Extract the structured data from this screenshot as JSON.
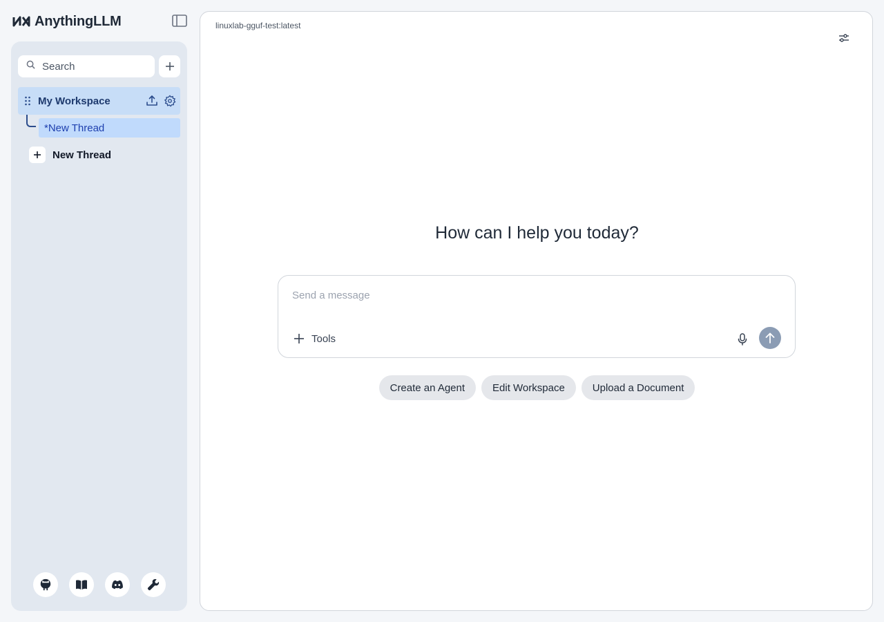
{
  "app": {
    "name": "AnythingLLM"
  },
  "sidebar": {
    "search_placeholder": "Search",
    "workspace": {
      "name": "My Workspace",
      "threads": [
        {
          "label": "*New Thread",
          "active": true
        }
      ]
    },
    "new_thread_label": "New Thread",
    "footer_icons": [
      "github-icon",
      "docs-book-icon",
      "discord-icon",
      "wrench-icon"
    ]
  },
  "main": {
    "model_name": "linuxlab-gguf-test:latest",
    "greeting": "How can I help you today?",
    "composer": {
      "placeholder": "Send a message",
      "value": "",
      "tools_label": "Tools"
    },
    "suggestions": [
      {
        "label": "Create an Agent"
      },
      {
        "label": "Edit Workspace"
      },
      {
        "label": "Upload a Document"
      }
    ]
  },
  "colors": {
    "page_bg": "#f4f6f9",
    "sidebar_bg": "#e2e8f0",
    "workspace_active_bg": "#c7ddf7",
    "thread_active_bg": "#c0dafc",
    "accent_text": "#1e3a6e",
    "send_button": "#8b9cb4",
    "chip_bg": "#e5e7eb"
  }
}
